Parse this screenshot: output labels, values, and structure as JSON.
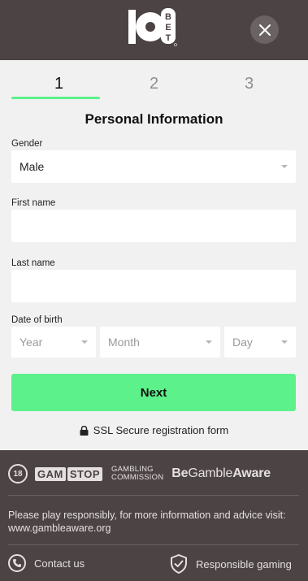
{
  "header": {
    "logo_digit": "10",
    "logo_word": "BET",
    "close_label": "×"
  },
  "steps": [
    {
      "label": "1",
      "active": true
    },
    {
      "label": "2",
      "active": false
    },
    {
      "label": "3",
      "active": false
    }
  ],
  "form": {
    "title": "Personal Information",
    "gender": {
      "label": "Gender",
      "value": "Male"
    },
    "first_name": {
      "label": "First name",
      "value": ""
    },
    "last_name": {
      "label": "Last name",
      "value": ""
    },
    "dob": {
      "label": "Date of birth",
      "year": "Year",
      "month": "Month",
      "day": "Day"
    },
    "next_label": "Next",
    "ssl_text": "SSL Secure registration form"
  },
  "footer": {
    "age_badge": "18",
    "gamstop_left": "GAM",
    "gamstop_right": "STOP",
    "gambling_commission_line1": "GAMBLING",
    "gambling_commission_line2": "COMMISSION",
    "begambleaware_be": "Be",
    "begambleaware_gamble": "Gamble",
    "begambleaware_aware": "Aware",
    "responsible_text": "Please play responsibly, for more information and advice visit: www.gambleaware.org",
    "contact_label": "Contact us",
    "responsible_gaming_label": "Responsible gaming"
  },
  "colors": {
    "brand_dark": "#4c4344",
    "accent_green": "#5cf18a",
    "page_bg": "#f1f1f1"
  }
}
